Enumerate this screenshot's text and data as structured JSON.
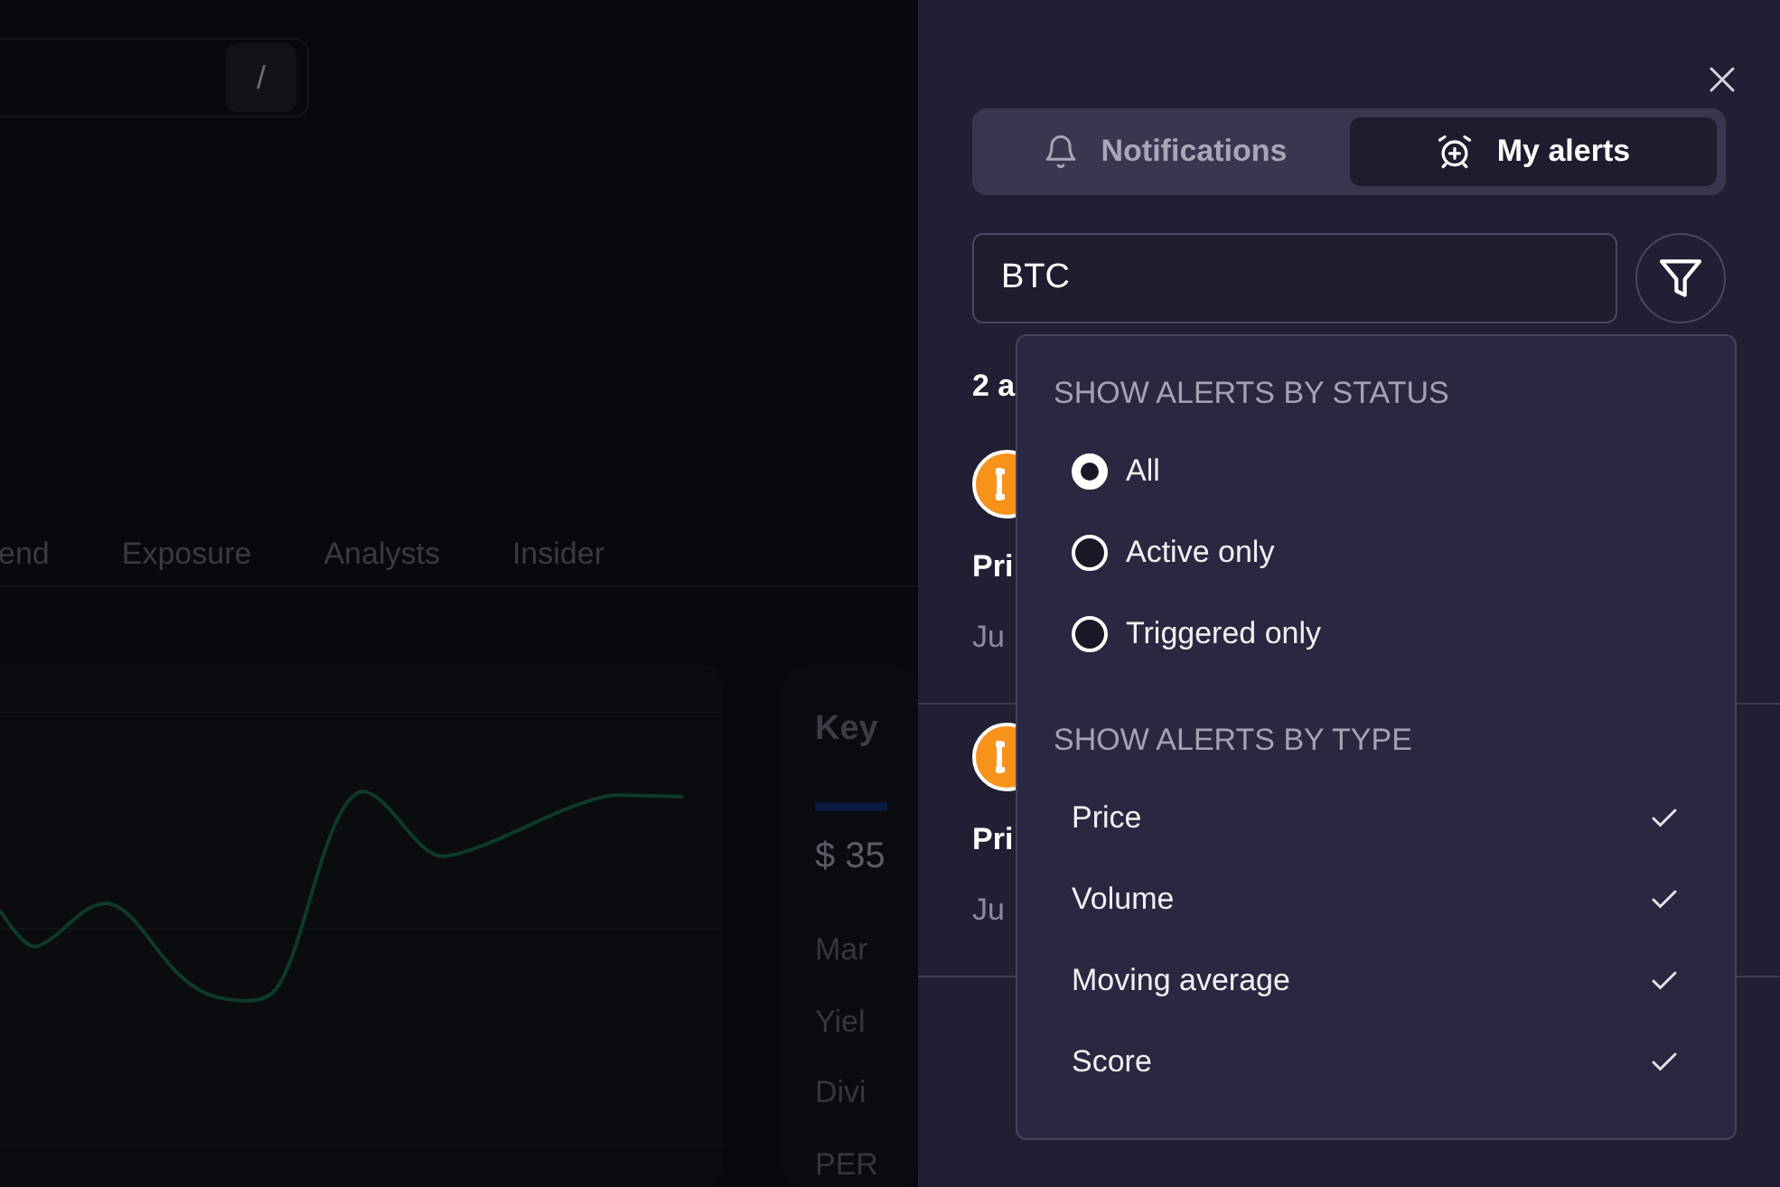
{
  "background": {
    "search": {
      "shortcut": "/"
    },
    "tabs": [
      {
        "label": "end"
      },
      {
        "label": "Exposure"
      },
      {
        "label": "Analysts"
      },
      {
        "label": "Insider"
      }
    ],
    "key_card": {
      "title": "Key",
      "value": "$ 35",
      "rows": [
        "Mar",
        "Yiel",
        "Divi",
        "PER"
      ]
    }
  },
  "panel": {
    "tabs": [
      {
        "label": "Notifications",
        "kind": "bell",
        "selected": false
      },
      {
        "label": "My alerts",
        "kind": "alarm",
        "selected": true
      }
    ],
    "search": {
      "value": "BTC"
    },
    "results_count": "2 a",
    "alerts": [
      {
        "title": "Pri",
        "date": "Ju"
      },
      {
        "title": "Pri",
        "date": "Ju"
      }
    ],
    "filter_menu": {
      "sections": [
        {
          "heading": "SHOW ALERTS BY STATUS",
          "kind": "radio",
          "options": [
            {
              "label": "All",
              "selected": true
            },
            {
              "label": "Active only",
              "selected": false
            },
            {
              "label": "Triggered only",
              "selected": false
            }
          ]
        },
        {
          "heading": "SHOW ALERTS BY TYPE",
          "kind": "check",
          "options": [
            {
              "label": "Price",
              "checked": true
            },
            {
              "label": "Volume",
              "checked": true
            },
            {
              "label": "Moving average",
              "checked": true
            },
            {
              "label": "Score",
              "checked": true
            }
          ]
        }
      ]
    }
  }
}
